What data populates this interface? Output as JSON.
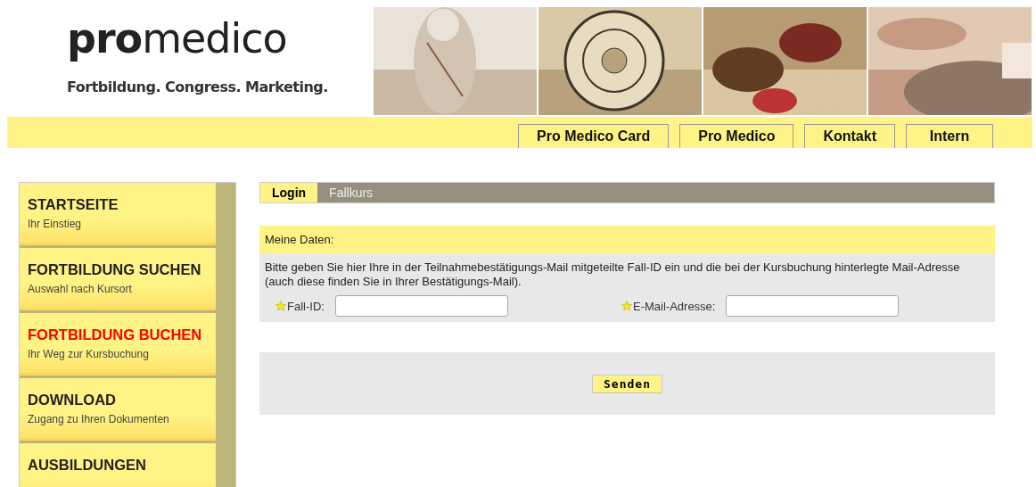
{
  "logo": {
    "name_bold": "pro",
    "name_rest": "medico",
    "tagline": "Fortbildung. Congress. Marketing."
  },
  "header_pictures": [
    {
      "kind": "picture"
    },
    {
      "kind": "picture"
    },
    {
      "kind": "picture"
    },
    {
      "kind": "picture"
    }
  ],
  "top_nav": [
    "Pro Medico Card",
    "Pro Medico",
    "Kontakt",
    "Intern"
  ],
  "sidebar": {
    "items": [
      {
        "title": "STARTSEITE",
        "subtitle": "Ihr Einstieg",
        "selected": false
      },
      {
        "title": "FORTBILDUNG SUCHEN",
        "subtitle": "Auswahl nach Kursort",
        "selected": false
      },
      {
        "title": "FORTBILDUNG BUCHEN",
        "subtitle": "Ihr Weg zur Kursbuchung",
        "selected": true
      },
      {
        "title": "DOWNLOAD",
        "subtitle": "Zugang zu Ihren Dokumenten",
        "selected": false
      },
      {
        "title": "AUSBILDUNGEN",
        "selected": false
      }
    ]
  },
  "tabs": [
    {
      "label": "Login",
      "selected": true
    },
    {
      "label": "Fallkurs",
      "selected": false
    }
  ],
  "form": {
    "heading": "Meine Daten:",
    "instructions": "Bitte geben Sie hier Ihre in der Teilnahmebestätigungs-Mail mitgeteilte Fall-ID ein und die bei der Kursbuchung hinterlegte Mail-Adresse (auch diese finden Sie in Ihrer Bestätigungs-Mail).",
    "fields": [
      {
        "label": "Fall-ID:",
        "required": true
      },
      {
        "label": "E-Mail-Adresse:",
        "required": true
      }
    ],
    "submit": "Senden"
  }
}
